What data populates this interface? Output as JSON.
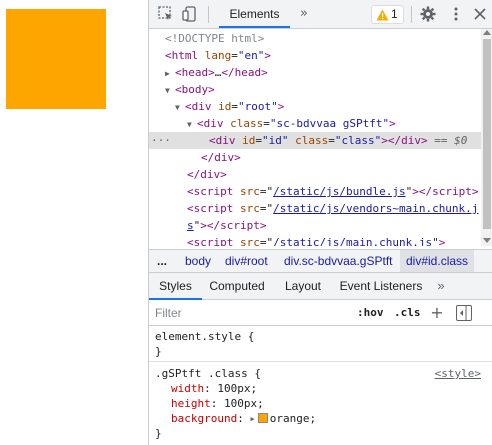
{
  "page": {
    "box_color": "#ffa500"
  },
  "devtools": {
    "toolbar": {
      "inspect_icon": "inspect-element-icon",
      "device_icon": "device-toggle-icon",
      "active_tab": "Elements",
      "more_tabs": "»",
      "warning_count": "1",
      "settings_icon": "gear-icon",
      "menu_icon": "kebab-menu-icon"
    },
    "dom": {
      "doctype": "<!DOCTYPE html>",
      "html_tag": "html",
      "html_attr": "lang",
      "html_val": "\"en\"",
      "head_tag": "head",
      "head_ellipsis": "…",
      "body_tag": "body",
      "root_tag": "div",
      "root_attr": "id",
      "root_val": "\"root\"",
      "sc_tag": "div",
      "sc_attr": "class",
      "sc_val": "\"sc-bdvvaa gSPtft\"",
      "sel_tag": "div",
      "sel_attr1": "id",
      "sel_val1": "\"id\"",
      "sel_attr2": "class",
      "sel_val2": "\"class\"",
      "sel_suffix": "== $0",
      "sel_dots": "···",
      "close_div": "div",
      "script_tag": "script",
      "script_attr": "src",
      "script1_src": "/static/js/bundle.js",
      "script2_src_a": "/static/js/vendors~main.chunk.j",
      "script2_src_b": "s",
      "script3_src": "/static/js/main.chunk.js"
    },
    "breadcrumbs": {
      "more": "...",
      "items": [
        "body",
        "div#root",
        "div.sc-bdvvaa.gSPtft",
        "div#id.class"
      ]
    },
    "sidebar_tabs": {
      "items": [
        "Styles",
        "Computed",
        "Layout",
        "Event Listeners"
      ],
      "more": "»"
    },
    "filter": {
      "placeholder": "Filter",
      "hov": ":hov",
      "cls": ".cls",
      "plus": "+"
    },
    "styles": {
      "element_style_selector": "element.style {",
      "element_style_close": "}",
      "rule_selector": ".gSPtft .class {",
      "rule_source": "<style>",
      "rule_close": "}",
      "props": [
        {
          "name": "width",
          "value": "100px;"
        },
        {
          "name": "height",
          "value": "100px;"
        },
        {
          "name": "background",
          "value": "orange;"
        }
      ],
      "swatch_color": "#ffa500"
    }
  }
}
